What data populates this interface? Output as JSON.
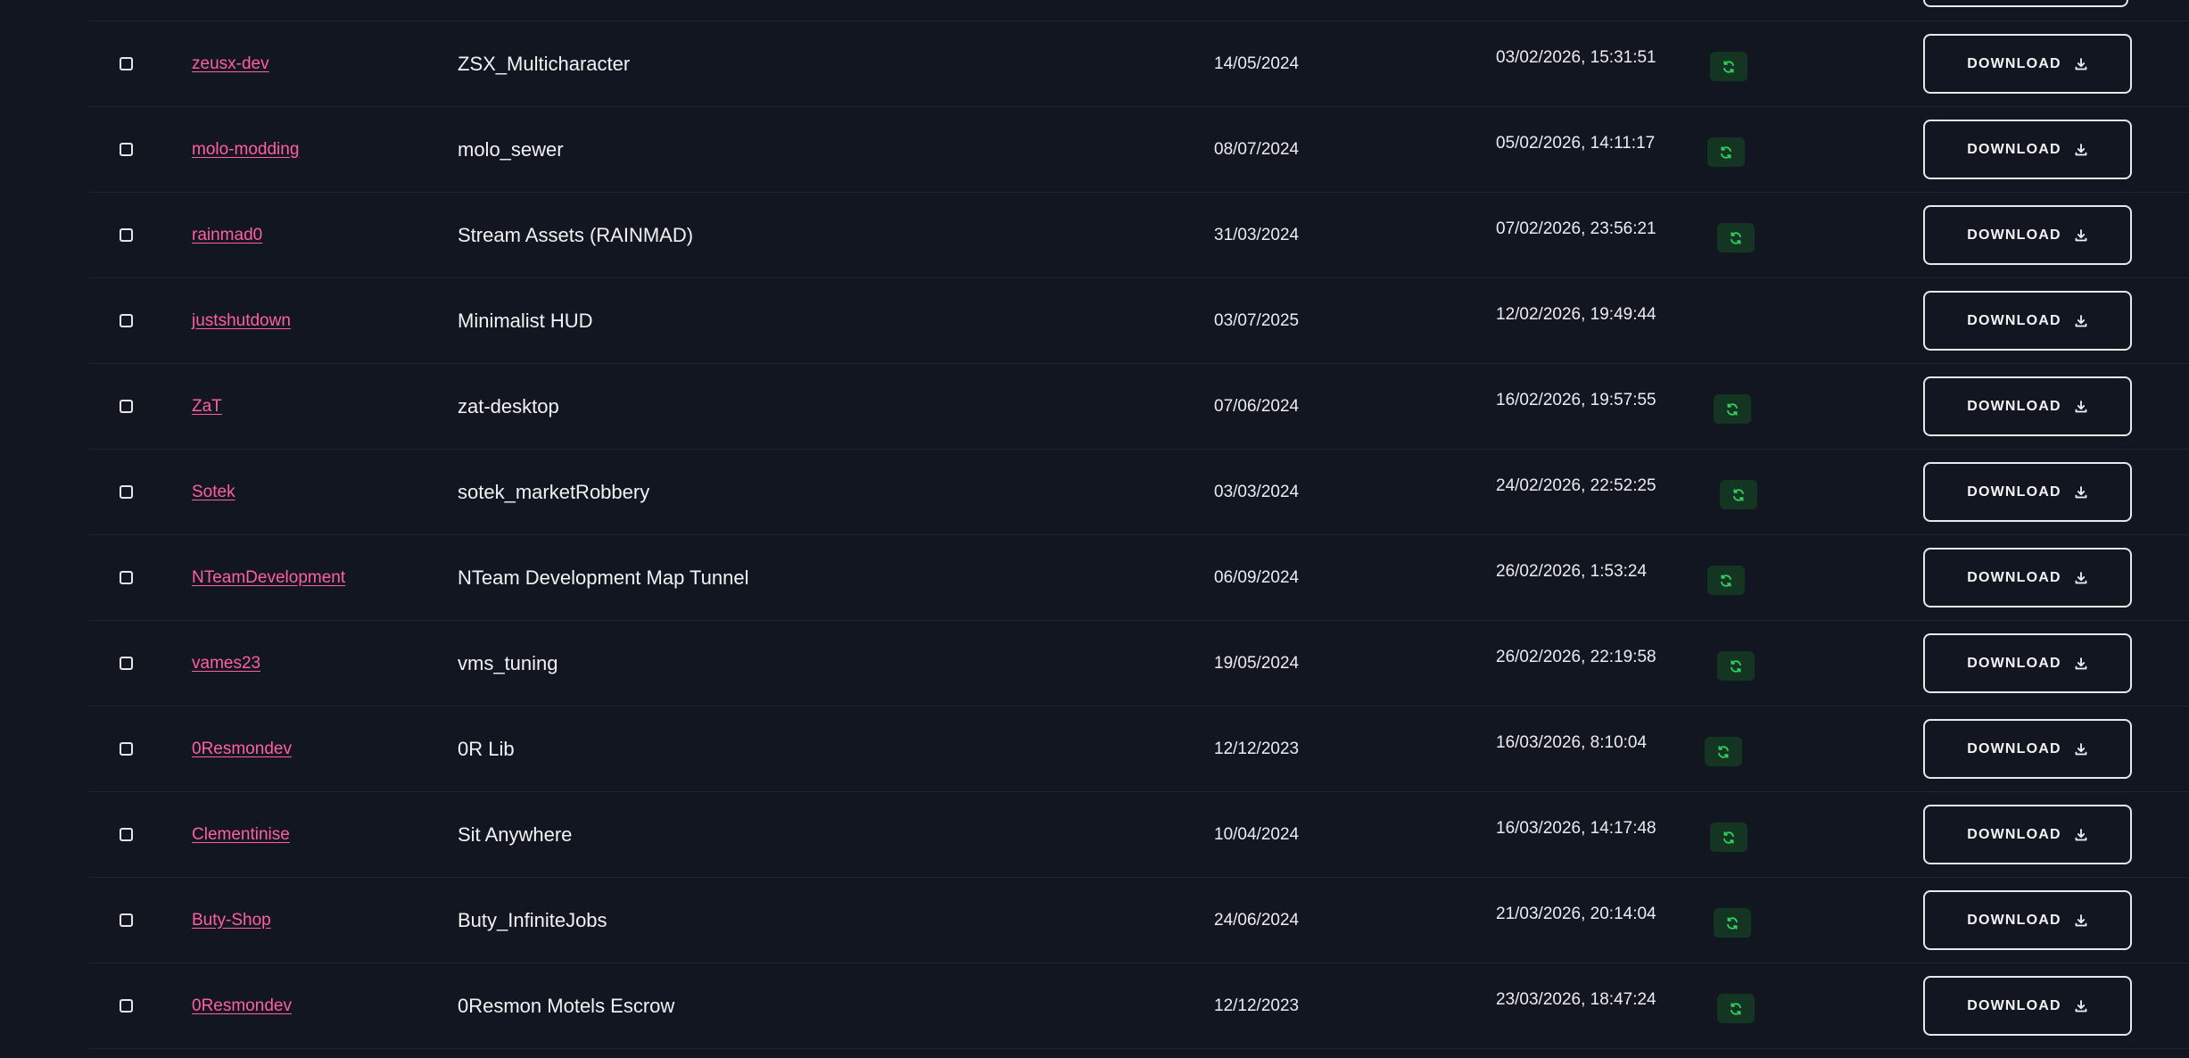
{
  "table": {
    "download_label": "DOWNLOAD",
    "rows": [
      {
        "author": "zeusx-dev",
        "name": "ZSX_Multicharacter",
        "date": "14/05/2024",
        "updated": "03/02/2026, 15:31:51",
        "synced": true
      },
      {
        "author": "molo-modding",
        "name": "molo_sewer",
        "date": "08/07/2024",
        "updated": "05/02/2026, 14:11:17",
        "synced": true
      },
      {
        "author": "rainmad0",
        "name": "Stream Assets (RAINMAD)",
        "date": "31/03/2024",
        "updated": "07/02/2026, 23:56:21",
        "synced": true
      },
      {
        "author": "justshutdown",
        "name": "Minimalist HUD",
        "date": "03/07/2025",
        "updated": "12/02/2026, 19:49:44",
        "synced": false
      },
      {
        "author": "ZaT",
        "name": "zat-desktop",
        "date": "07/06/2024",
        "updated": "16/02/2026, 19:57:55",
        "synced": true
      },
      {
        "author": "Sotek",
        "name": "sotek_marketRobbery",
        "date": "03/03/2024",
        "updated": "24/02/2026, 22:52:25",
        "synced": true
      },
      {
        "author": "NTeamDevelopment",
        "name": "NTeam Development Map Tunnel",
        "date": "06/09/2024",
        "updated": "26/02/2026, 1:53:24",
        "synced": true
      },
      {
        "author": "vames23",
        "name": "vms_tuning",
        "date": "19/05/2024",
        "updated": "26/02/2026, 22:19:58",
        "synced": true
      },
      {
        "author": "0Resmondev",
        "name": "0R Lib",
        "date": "12/12/2023",
        "updated": "16/03/2026, 8:10:04",
        "synced": true
      },
      {
        "author": "Clementinise",
        "name": "Sit Anywhere",
        "date": "10/04/2024",
        "updated": "16/03/2026, 14:17:48",
        "synced": true
      },
      {
        "author": "Buty-Shop",
        "name": "Buty_InfiniteJobs",
        "date": "24/06/2024",
        "updated": "21/03/2026, 20:14:04",
        "synced": true
      },
      {
        "author": "0Resmondev",
        "name": "0Resmon Motels Escrow",
        "date": "12/12/2023",
        "updated": "23/03/2026, 18:47:24",
        "synced": true
      }
    ]
  },
  "icons": {
    "sync": "refresh-icon",
    "download": "download-icon"
  },
  "colors": {
    "background": "#121620",
    "author_link": "#ff5fa2",
    "sync_badge_bg": "#153523",
    "sync_icon": "#2fd15f",
    "border": "#e8e8ea"
  }
}
